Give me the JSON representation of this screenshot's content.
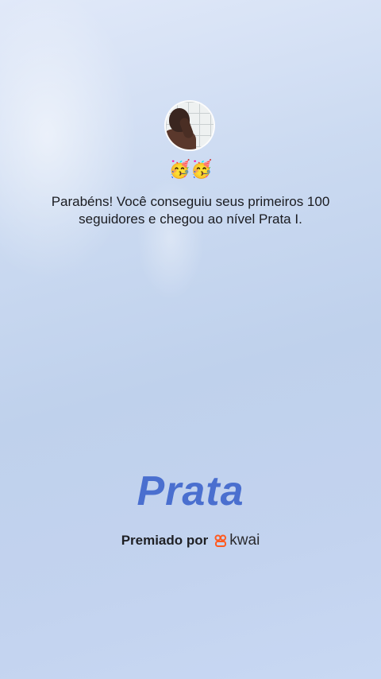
{
  "message": "Parabéns! Você conseguiu seus primeiros 100 seguidores e chegou ao nível Prata I.",
  "emojis": "🥳🥳",
  "tier_name": "Prata",
  "awarded_by_label": "Premiado por",
  "brand_name": "kwai",
  "colors": {
    "tier_text": "#4a6fcf",
    "brand_icon": "#ff5a1f"
  },
  "icons": {
    "avatar": "profile-photo",
    "brand": "kwai-logo-icon"
  }
}
